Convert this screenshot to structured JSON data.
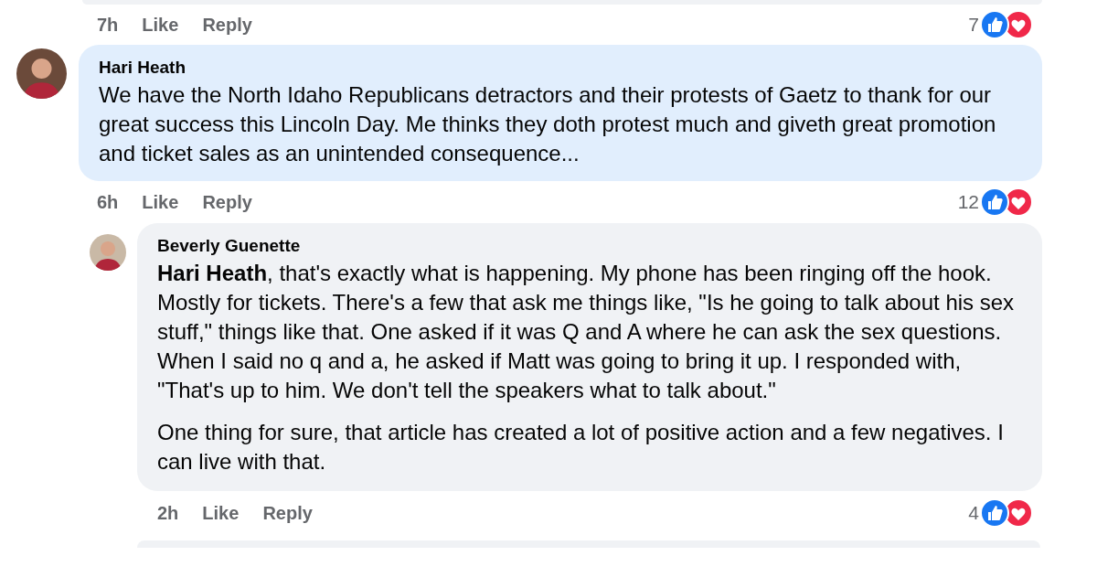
{
  "previous_comment": {
    "time": "7h",
    "actions": [
      "Like",
      "Reply"
    ],
    "reaction_count": "7"
  },
  "comments": [
    {
      "author": "Hari Heath",
      "highlighted": true,
      "paragraphs": [
        "We have the North Idaho Republicans detractors and their protests of Gaetz to thank for our great success this Lincoln Day. Me thinks they doth protest much and giveth great promotion and ticket sales as an unintended consequence..."
      ],
      "time": "6h",
      "actions": [
        "Like",
        "Reply"
      ],
      "reaction_count": "12",
      "replies": [
        {
          "author": "Beverly Guenette",
          "highlighted": false,
          "paragraphs": [
            "**Hari Heath**, that's exactly what is happening. My phone has been ringing off the hook. Mostly for tickets. There's a few that ask me things like, \"Is he going to talk about his sex stuff,\" things like that. One asked if it was Q and A where he can ask the sex questions. When I said no q and a, he asked if Matt was going to bring it up. I responded with, \"That's up to him. We don't tell the speakers what to talk about.\"",
            "One thing for sure, that article has created a lot of positive action and a few negatives. I can live with that."
          ],
          "time": "2h",
          "actions": [
            "Like",
            "Reply"
          ],
          "reaction_count": "4"
        }
      ]
    }
  ]
}
